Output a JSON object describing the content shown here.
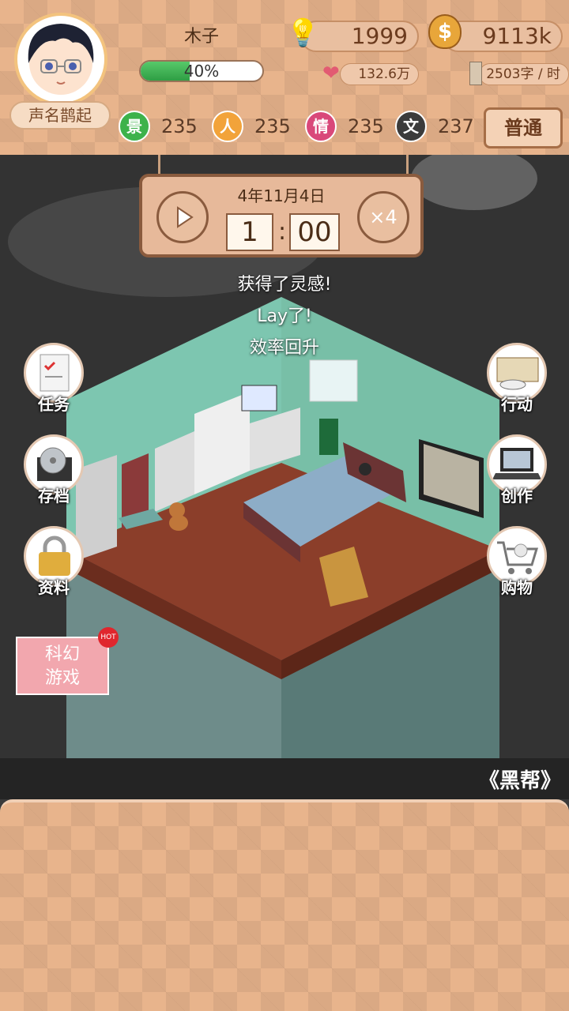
{
  "player": {
    "name": "木子",
    "title": "声名鹊起",
    "progress_text": "40%",
    "progress_value": 0.4
  },
  "resources": {
    "inspiration": "1999",
    "money": "9113k",
    "fans": "132.6万",
    "speed": "2503字 / 时"
  },
  "stats": [
    {
      "icon": "景",
      "value": "235",
      "color": "#3db24b"
    },
    {
      "icon": "人",
      "value": "235",
      "color": "#f2a33a"
    },
    {
      "icon": "情",
      "value": "235",
      "color": "#d9487a"
    },
    {
      "icon": "文",
      "value": "237",
      "color": "#3b3b3b"
    }
  ],
  "mode_button": "普通",
  "time": {
    "date": "4年11月4日",
    "hour": "1",
    "minute": "00",
    "speed": "×4"
  },
  "messages": [
    "获得了灵感!",
    "Lay了!",
    "效率回升"
  ],
  "side_left": [
    "任务",
    "存档",
    "资料"
  ],
  "side_right": [
    "行动",
    "创作",
    "购物"
  ],
  "promo": {
    "line1": "科幻",
    "line2": "游戏",
    "badge": "HOT"
  },
  "novel_title": "《黑帮》",
  "colors": {
    "panel": "#e8b48c",
    "border": "#8a5b3e",
    "progress": "#3ab54a"
  }
}
